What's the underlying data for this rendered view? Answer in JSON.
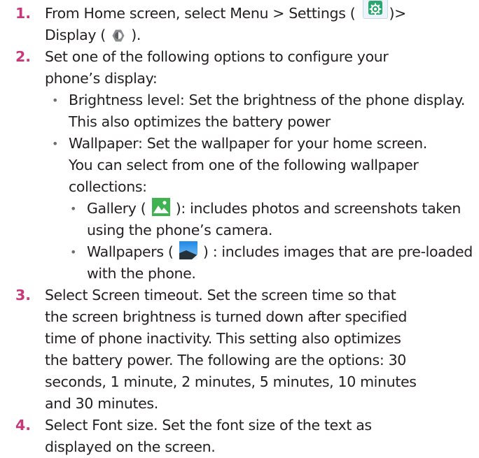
{
  "steps": [
    {
      "number": "1.",
      "line1_before": "From Home screen, select Menu > Settings (",
      "line1_after": ")>",
      "line2_before": "Display (",
      "line2_after": ")."
    },
    {
      "number": "2.",
      "lines": [
        "Set one of the following options to configure your",
        "phone’s display:"
      ],
      "bullets": [
        {
          "lines": [
            "Brightness level: Set the brightness of the phone display.",
            "This also optimizes the battery power"
          ]
        },
        {
          "lines": [
            "Wallpaper:  Set the wallpaper for your home screen.",
            "You can select from one of the following wallpaper",
            "collections:"
          ],
          "sub_bullets": [
            {
              "before": "Gallery (",
              "after": "): includes photos and screenshots taken",
              "line2": "using the phone’s camera."
            },
            {
              "before": "Wallpapers (",
              "after": ") : includes images that are pre-loaded",
              "line2": "with the phone."
            }
          ]
        }
      ]
    },
    {
      "number": "3.",
      "lines": [
        "Select Screen timeout. Set the screen time so that",
        "the screen brightness is turned down after specified",
        "time of phone inactivity. This setting also optimizes",
        "the battery power. The following are the options: 30",
        "seconds, 1 minute, 2 minutes, 5 minutes, 10 minutes",
        "and 30 minutes."
      ]
    },
    {
      "number": "4.",
      "lines": [
        "Select Font size. Set the font size of the text as",
        "displayed on the screen."
      ]
    }
  ],
  "bullet_glyph": "•",
  "icons": {
    "settings": "settings-gear-icon",
    "display": "display-brightness-icon",
    "gallery": "gallery-icon",
    "wallpapers": "wallpapers-icon"
  },
  "colors": {
    "step_number": "#c8377a",
    "text": "#231f20",
    "settings_icon": "#2aa66e",
    "gallery_icon": "#3fb34f"
  }
}
